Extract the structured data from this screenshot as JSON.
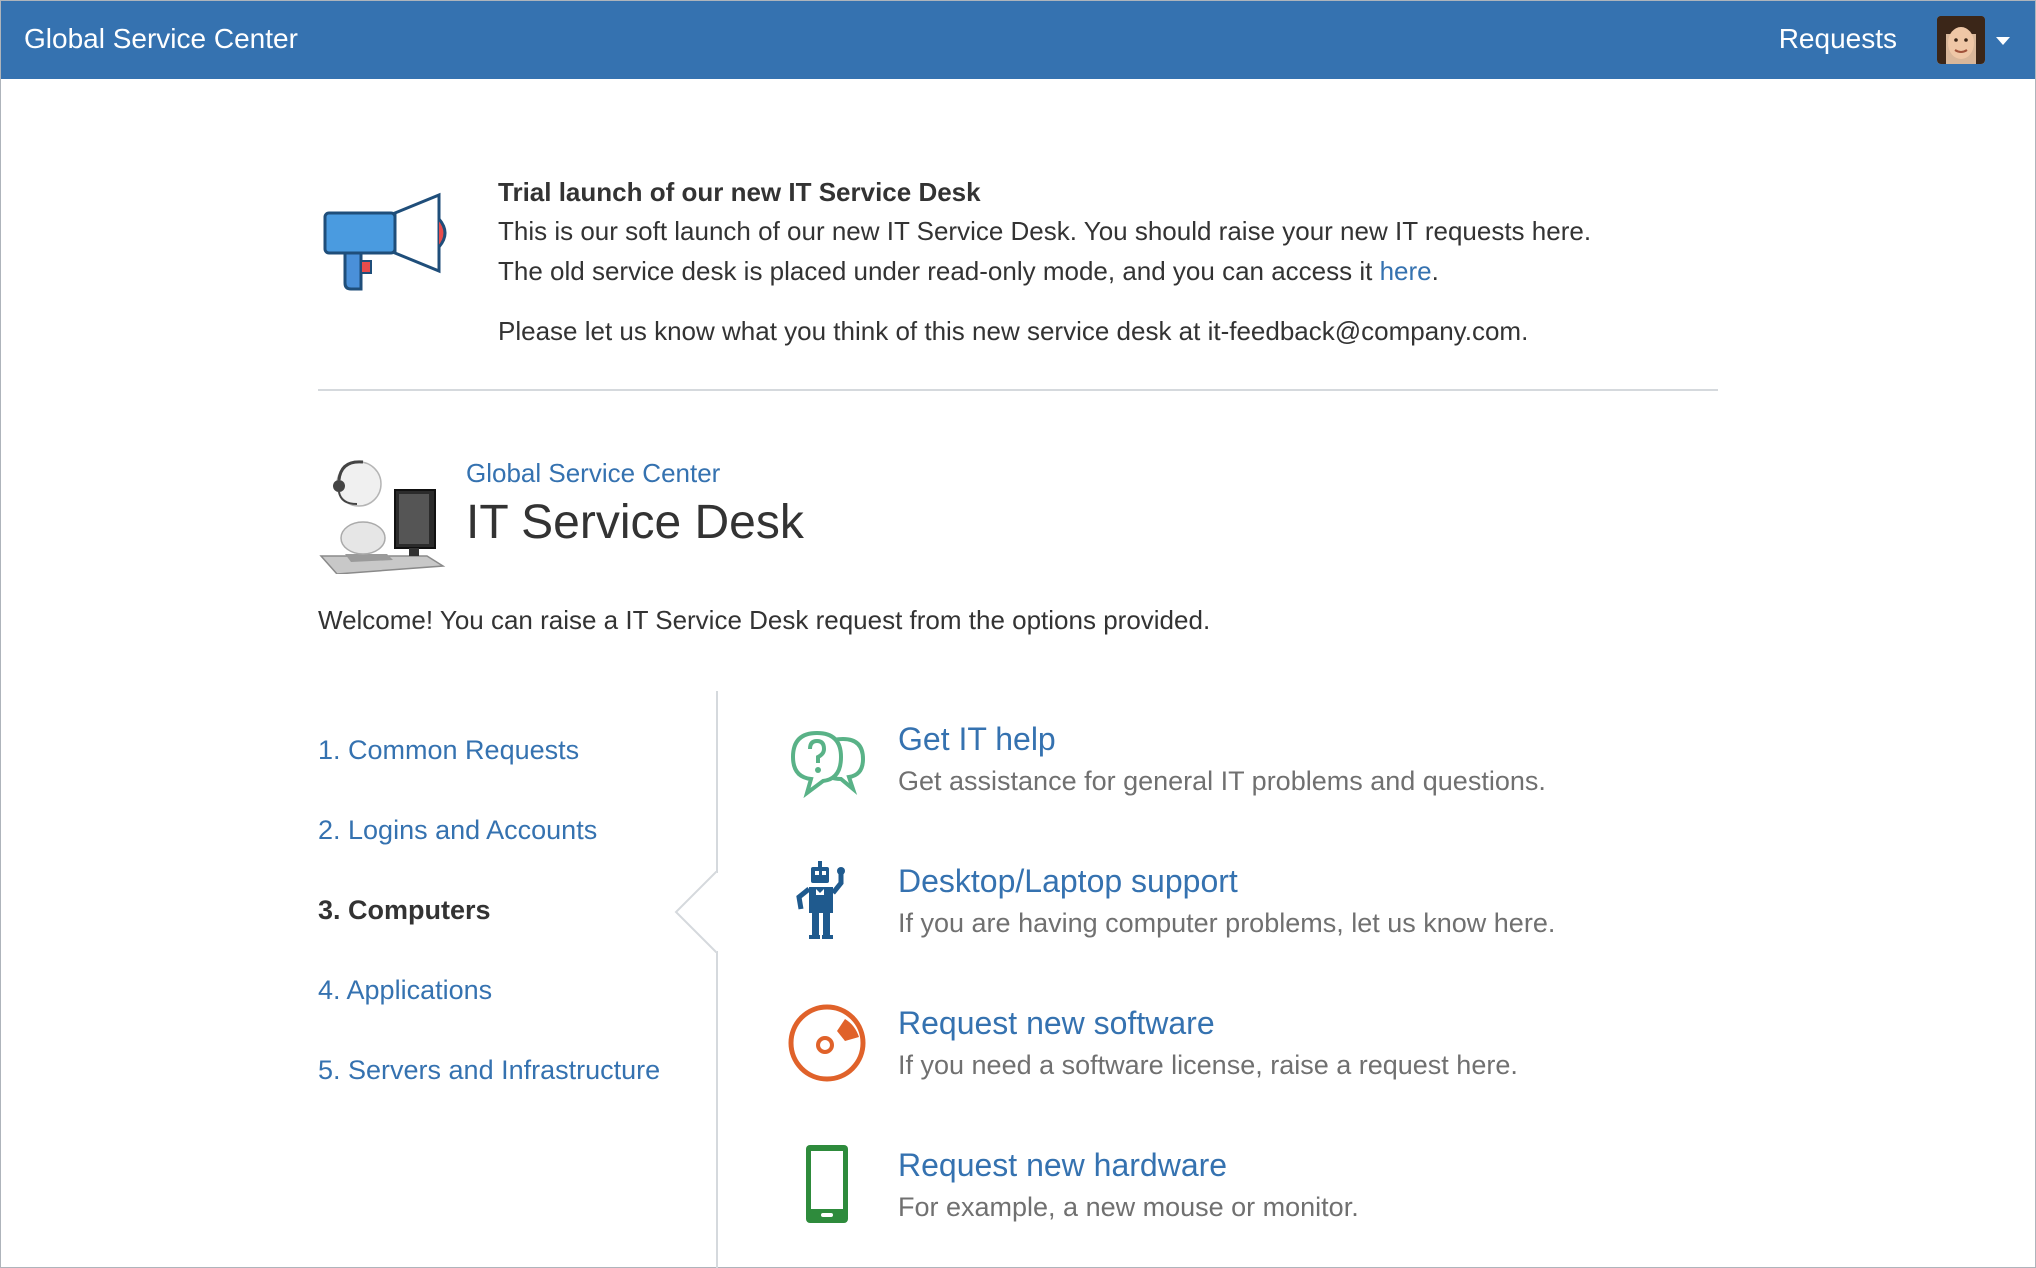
{
  "topbar": {
    "brand": "Global Service Center",
    "requests_label": "Requests",
    "avatar_icon": "user-avatar",
    "menu_icon": "chevron-down-icon",
    "bar_color": "#3572b0"
  },
  "announcement": {
    "icon": "megaphone-icon",
    "title": "Trial launch of our new IT Service Desk",
    "line1": "This is our soft launch of our new IT Service Desk. You should raise your new IT requests here.",
    "line2_prefix": "The old service desk is placed under read-only mode, and you can access it ",
    "line2_link": "here",
    "line2_suffix": ".",
    "line3": "Please let us know what you think of this new service desk at it-feedback@company.com."
  },
  "desk": {
    "portal_link": "Global Service Center",
    "name": "IT Service Desk",
    "avatar": "support-agent-icon",
    "welcome": "Welcome! You can raise a IT Service Desk request from the options provided."
  },
  "groups": [
    {
      "label": "1. Common Requests",
      "active": false
    },
    {
      "label": "2. Logins and Accounts",
      "active": false
    },
    {
      "label": "3. Computers",
      "active": true
    },
    {
      "label": "4. Applications",
      "active": false
    },
    {
      "label": "5. Servers and Infrastructure",
      "active": false
    }
  ],
  "request_types": [
    {
      "title": "Get IT help",
      "description": "Get assistance for general IT problems and questions.",
      "icon": "question-bubbles-icon",
      "color": "#59b287"
    },
    {
      "title": "Desktop/Laptop support",
      "description": "If you are having computer problems, let us know here.",
      "icon": "robot-icon",
      "color": "#1f5a8e"
    },
    {
      "title": "Request new software",
      "description": "If you need a software license, raise a request here.",
      "icon": "software-disc-icon",
      "color": "#e0622a"
    },
    {
      "title": "Request new hardware",
      "description": "For example, a new mouse or monitor.",
      "icon": "phone-device-icon",
      "color": "#2e8b3c"
    }
  ]
}
